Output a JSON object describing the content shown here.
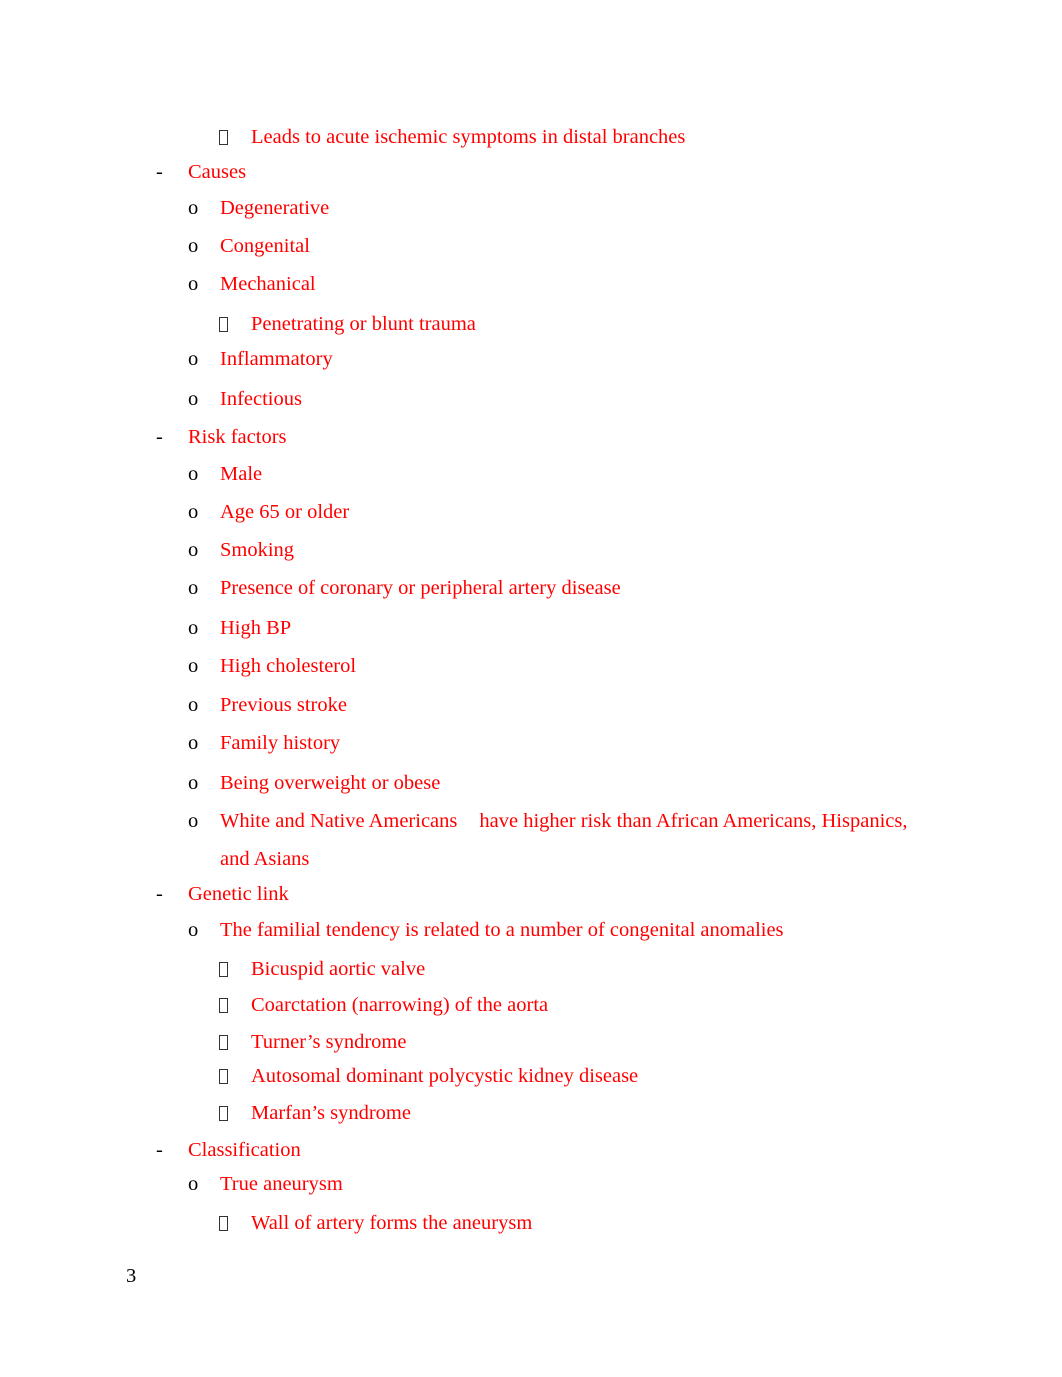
{
  "document": {
    "page_number": "3",
    "text_color": "#ff0000",
    "markers": {
      "level1": "-",
      "level2": "o",
      "level3": "missing-glyph-box"
    },
    "lines": [
      {
        "level": 3,
        "text": "Leads to acute ischemic symptoms in distal branches"
      },
      {
        "level": 1,
        "text": "Causes"
      },
      {
        "level": 2,
        "text": "Degenerative"
      },
      {
        "level": 2,
        "text": "Congenital"
      },
      {
        "level": 2,
        "text": "Mechanical"
      },
      {
        "level": 3,
        "text": "Penetrating or blunt trauma"
      },
      {
        "level": 2,
        "text": "Inflammatory"
      },
      {
        "level": 2,
        "text": "Infectious"
      },
      {
        "level": 1,
        "text": "Risk factors"
      },
      {
        "level": 2,
        "text": "Male"
      },
      {
        "level": 2,
        "text": "Age 65 or older"
      },
      {
        "level": 2,
        "text": "Smoking"
      },
      {
        "level": 2,
        "text": "Presence of coronary or peripheral artery disease"
      },
      {
        "level": 2,
        "text": "High BP"
      },
      {
        "level": 2,
        "text": "High cholesterol"
      },
      {
        "level": 2,
        "text": "Previous stroke"
      },
      {
        "level": 2,
        "text": "Family history"
      },
      {
        "level": 2,
        "text": "Being overweight or obese"
      },
      {
        "level": 2,
        "text_part1": "White and Native Americans",
        "text_part2": "have higher risk than African Americans, Hispanics,",
        "continuation": "and Asians"
      },
      {
        "level": 1,
        "text": "Genetic link"
      },
      {
        "level": 2,
        "text": "The familial tendency is related to a number of congenital anomalies"
      },
      {
        "level": 3,
        "text": "Bicuspid aortic valve"
      },
      {
        "level": 3,
        "text": "Coarctation (narrowing) of the aorta"
      },
      {
        "level": 3,
        "text": "Turner’s syndrome"
      },
      {
        "level": 3,
        "text": "Autosomal dominant polycystic kidney disease"
      },
      {
        "level": 3,
        "text": "Marfan’s syndrome"
      },
      {
        "level": 1,
        "text": "Classification"
      },
      {
        "level": 2,
        "text": "True aneurysm"
      },
      {
        "level": 3,
        "text": "Wall of artery forms the aneurysm"
      }
    ]
  }
}
